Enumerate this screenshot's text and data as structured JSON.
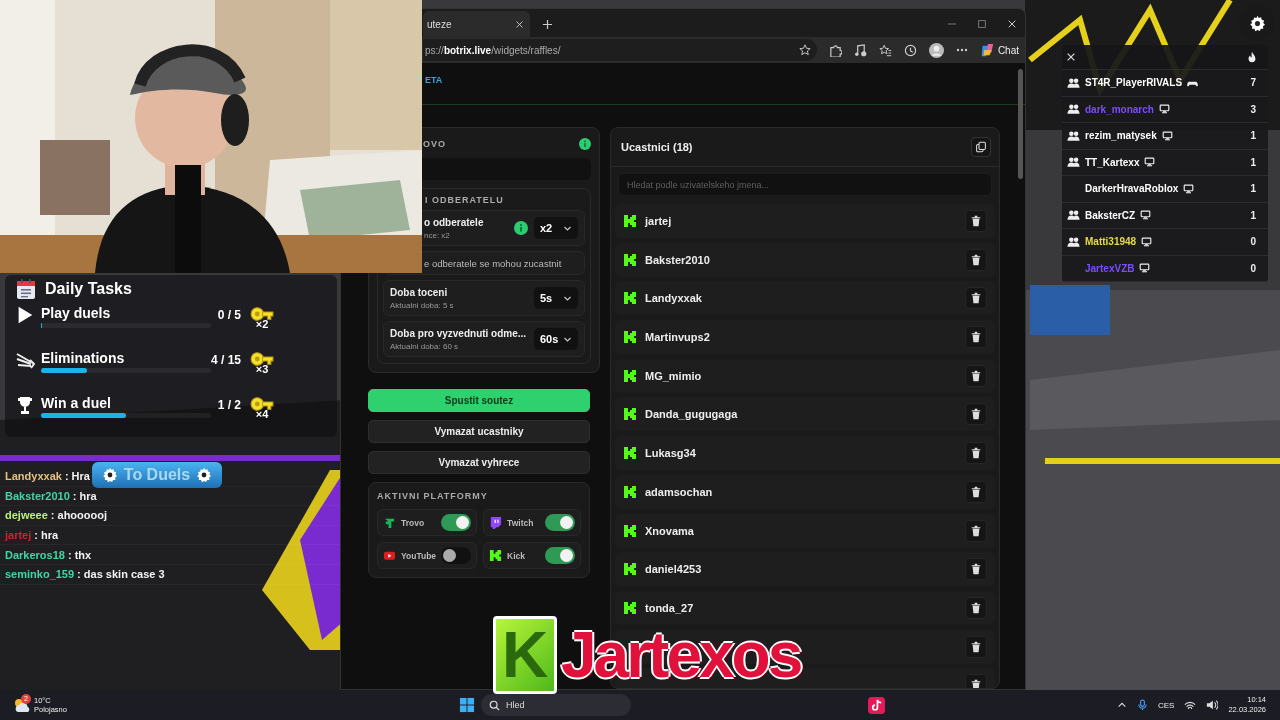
{
  "browser": {
    "tab_title": "uteze",
    "address": "ps://**botrix.live**/widgets/raffles/",
    "chat_label": "Chat",
    "header_badge": "ETA"
  },
  "settings_panel": {
    "title": "OVO",
    "info": true,
    "section": "I ODBERATELU",
    "rows": [
      {
        "kind": "select",
        "label": "o odberatele",
        "hint": "nce: x2",
        "info": true,
        "value": "x2"
      },
      {
        "kind": "note",
        "label": "e odberatele se mohou zucastnit"
      },
      {
        "kind": "select",
        "label": "Doba toceni",
        "hint": "Aktualni doba: 5 s",
        "info": false,
        "value": "5s"
      },
      {
        "kind": "select",
        "label": "Doba pro vyzvednuti odme...",
        "hint": "Aktualni doba: 60 s",
        "info": false,
        "value": "60s"
      }
    ],
    "buttons": [
      {
        "label": "Spustit soutez",
        "primary": true
      },
      {
        "label": "Vymazat ucastniky",
        "primary": false
      },
      {
        "label": "Vymazat vyhrece",
        "primary": false
      }
    ],
    "platforms_title": "AKTIVNI PLATFORMY",
    "platforms": [
      {
        "name": "Trovo",
        "kind": "trovo",
        "on": true
      },
      {
        "name": "Twitch",
        "kind": "twitch",
        "on": true
      },
      {
        "name": "YouTube",
        "kind": "youtube",
        "on": false
      },
      {
        "name": "Kick",
        "kind": "kick",
        "on": true
      }
    ]
  },
  "participants": {
    "title": "Ucastnici (18)",
    "search_placeholder": "Hledat podle uzivatelskeho jmena...",
    "rows": [
      {
        "kind": "named",
        "name": "jartej"
      },
      {
        "kind": "named",
        "name": "Bakster2010"
      },
      {
        "kind": "named",
        "name": "Landyxxak"
      },
      {
        "kind": "named",
        "name": "Martinvups2"
      },
      {
        "kind": "named",
        "name": "MG_mimio"
      },
      {
        "kind": "named",
        "name": "Danda_gugugaga"
      },
      {
        "kind": "named",
        "name": "Lukasg34"
      },
      {
        "kind": "named",
        "name": "adamsochan"
      },
      {
        "kind": "named",
        "name": "Xnovama"
      },
      {
        "kind": "named",
        "name": "daniel4253"
      },
      {
        "kind": "named",
        "name": "tonda_27"
      },
      {
        "kind": "covered"
      },
      {
        "kind": "covered"
      }
    ]
  },
  "daily_tasks": {
    "title": "Daily Tasks",
    "tasks": [
      {
        "kind": "play",
        "label": "Play duels",
        "progress": "0 / 5",
        "level": 0,
        "reward": "×2"
      },
      {
        "kind": "eliminate",
        "label": "Eliminations",
        "progress": "4 / 15",
        "level": 0.27,
        "reward": "×3"
      },
      {
        "kind": "win",
        "label": "Win a duel",
        "progress": "1 / 2",
        "level": 0.5,
        "reward": "×4"
      }
    ],
    "button": "To Duels"
  },
  "chat": [
    {
      "user": "Landyxxak",
      "color": "#e6c27e",
      "text": ": Hra"
    },
    {
      "user": "Bakster2010",
      "color": "#3fd6a2",
      "text": ": hra"
    },
    {
      "user": "dejweee",
      "color": "#b8f27c",
      "text": ": ahoooooj"
    },
    {
      "user": "jartej",
      "color": "#cc2233",
      "text": ": hra"
    },
    {
      "user": "Darkeros18",
      "color": "#3fd6a2",
      "text": ": thx"
    },
    {
      "user": "seminko_159",
      "color": "#3fd6a2",
      "text": ": das skin case 3"
    }
  ],
  "scoreboard": {
    "rows": [
      {
        "name": "ST4R_PlayerRIVALS",
        "color": "#ffffff",
        "grouped": true,
        "kind": "controller",
        "score": "7"
      },
      {
        "name": "dark_monarch",
        "color": "#7b4dff",
        "grouped": true,
        "kind": "pc",
        "score": "3"
      },
      {
        "name": "rezim_matysek",
        "color": "#ffffff",
        "grouped": true,
        "kind": "pc",
        "score": "1"
      },
      {
        "name": "TT_Kartexx",
        "color": "#ffffff",
        "grouped": true,
        "kind": "pc",
        "score": "1"
      },
      {
        "name": "DarkerHravaRoblox",
        "color": "#ffffff",
        "grouped": false,
        "kind": "pc",
        "score": "1"
      },
      {
        "name": "BaksterCZ",
        "color": "#ffffff",
        "grouped": true,
        "kind": "pc",
        "score": "1"
      },
      {
        "name": "Matti31948",
        "color": "#e8d84a",
        "grouped": true,
        "kind": "pc",
        "score": "0"
      },
      {
        "name": "JartexVZB",
        "color": "#7b4dff",
        "grouped": false,
        "kind": "pc",
        "score": "0"
      }
    ]
  },
  "logo": {
    "badge": "K",
    "text": "Jartexos"
  },
  "taskbar": {
    "weather_badge": "2",
    "temperature": "10°C",
    "condition": "Polojasno",
    "search": "Hled",
    "language": "CES",
    "time": "10:14",
    "date": "22.03.2026"
  }
}
